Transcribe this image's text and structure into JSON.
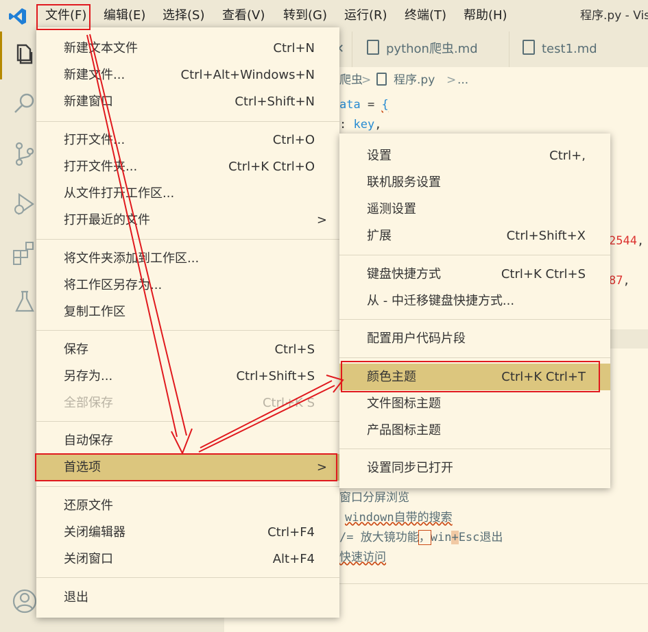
{
  "menubar": {
    "items": [
      {
        "label": "文件(F)"
      },
      {
        "label": "编辑(E)"
      },
      {
        "label": "选择(S)"
      },
      {
        "label": "查看(V)"
      },
      {
        "label": "转到(G)"
      },
      {
        "label": "运行(R)"
      },
      {
        "label": "终端(T)"
      },
      {
        "label": "帮助(H)"
      }
    ],
    "window_title": "程序.py - Vis"
  },
  "tabs": [
    {
      "label": "python爬虫.md"
    },
    {
      "label": "test1.md"
    }
  ],
  "breadcrumb": {
    "folder": "爬虫",
    "sep": ">",
    "file": "程序.py",
    "more": "..."
  },
  "code": {
    "l1_a": "ata",
    "l1_b": " = ",
    "l1_c": "{",
    "l2_a": ": ",
    "l2_b": "key",
    "l2_c": ",",
    "l3_a": "2544",
    "l4_a": "87",
    "l5": "窗口分屏浏览",
    "l6": "windown自带的搜索",
    "l7_a": "/= 放大镜功能",
    "l7_b": "，",
    "l7_c": "win",
    "l7_d": "+",
    "l7_e": "Esc退出",
    "l8": "快速访问"
  },
  "file_menu": {
    "items": [
      {
        "label": "新建文本文件",
        "kb": "Ctrl+N"
      },
      {
        "label": "新建文件...",
        "kb": "Ctrl+Alt+Windows+N"
      },
      {
        "label": "新建窗口",
        "kb": "Ctrl+Shift+N"
      },
      {
        "label": "打开文件...",
        "kb": "Ctrl+O"
      },
      {
        "label": "打开文件夹...",
        "kb": "Ctrl+K Ctrl+O"
      },
      {
        "label": "从文件打开工作区...",
        "kb": ""
      },
      {
        "label": "打开最近的文件",
        "kb": ""
      },
      {
        "label": "将文件夹添加到工作区...",
        "kb": ""
      },
      {
        "label": "将工作区另存为...",
        "kb": ""
      },
      {
        "label": "复制工作区",
        "kb": ""
      },
      {
        "label": "保存",
        "kb": "Ctrl+S"
      },
      {
        "label": "另存为...",
        "kb": "Ctrl+Shift+S"
      },
      {
        "label": "全部保存",
        "kb": "Ctrl+K S"
      },
      {
        "label": "自动保存",
        "kb": ""
      },
      {
        "label": "首选项",
        "kb": ""
      },
      {
        "label": "还原文件",
        "kb": ""
      },
      {
        "label": "关闭编辑器",
        "kb": "Ctrl+F4"
      },
      {
        "label": "关闭窗口",
        "kb": "Alt+F4"
      },
      {
        "label": "退出",
        "kb": ""
      }
    ],
    "submenu_arrow": ">"
  },
  "pref_menu": {
    "items": [
      {
        "label": "设置",
        "kb": "Ctrl+,"
      },
      {
        "label": "联机服务设置",
        "kb": ""
      },
      {
        "label": "遥测设置",
        "kb": ""
      },
      {
        "label": "扩展",
        "kb": "Ctrl+Shift+X"
      },
      {
        "label": "键盘快捷方式",
        "kb": "Ctrl+K Ctrl+S"
      },
      {
        "label": "从 - 中迁移键盘快捷方式...",
        "kb": ""
      },
      {
        "label": "配置用户代码片段",
        "kb": ""
      },
      {
        "label": "颜色主题",
        "kb": "Ctrl+K Ctrl+T"
      },
      {
        "label": "文件图标主题",
        "kb": ""
      },
      {
        "label": "产品图标主题",
        "kb": ""
      },
      {
        "label": "设置同步已打开",
        "kb": ""
      }
    ]
  },
  "colors": {
    "accent": "#b58900",
    "selection": "#dcc67e",
    "annotation": "#e0191e"
  }
}
